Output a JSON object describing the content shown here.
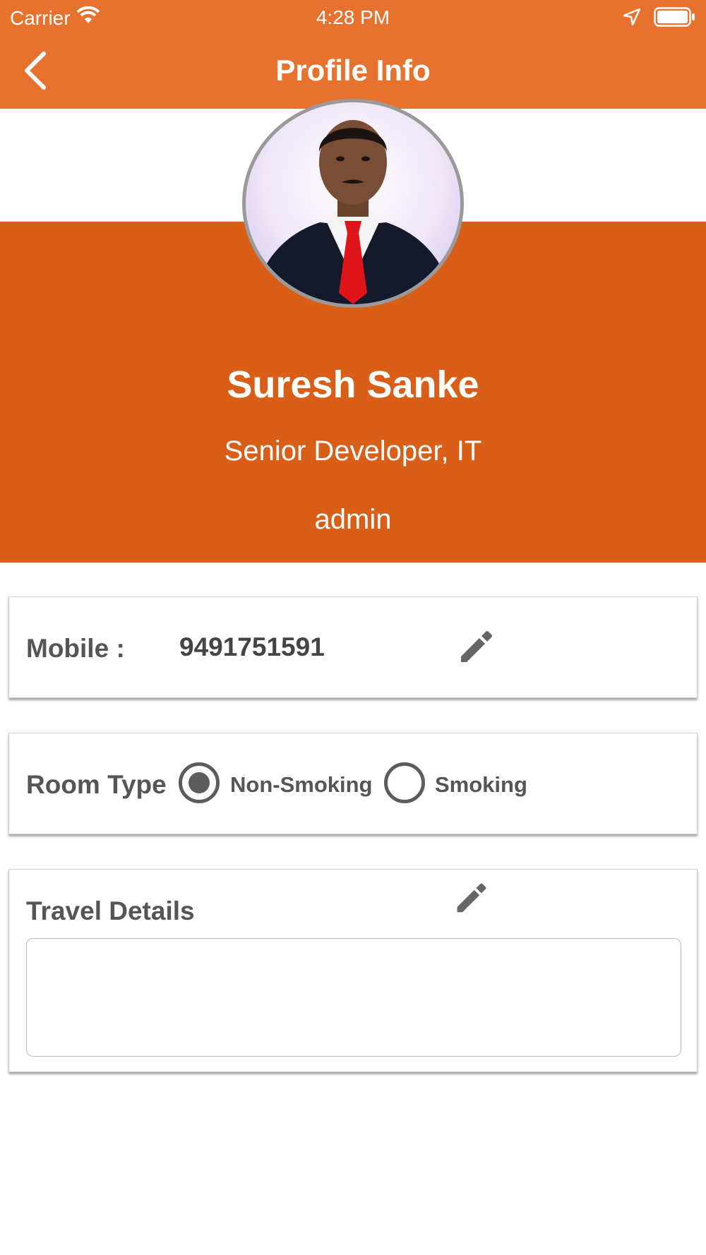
{
  "status_bar": {
    "carrier": "Carrier",
    "time": "4:28 PM"
  },
  "nav": {
    "title": "Profile Info",
    "back_icon": "chevron-left-icon"
  },
  "profile": {
    "name": "Suresh Sanke",
    "role": "Senior Developer, IT",
    "username": "admin"
  },
  "mobile_card": {
    "label": "Mobile :",
    "value": "9491751591",
    "edit_icon": "pencil-icon"
  },
  "room_card": {
    "label": "Room Type",
    "options": [
      {
        "label": "Non-Smoking",
        "selected": true
      },
      {
        "label": "Smoking",
        "selected": false
      }
    ]
  },
  "travel_card": {
    "label": "Travel Details",
    "value": "",
    "edit_icon": "pencil-icon"
  },
  "colors": {
    "header": "#e7722e",
    "hero": "#d95f19",
    "text_gray": "#555555"
  }
}
